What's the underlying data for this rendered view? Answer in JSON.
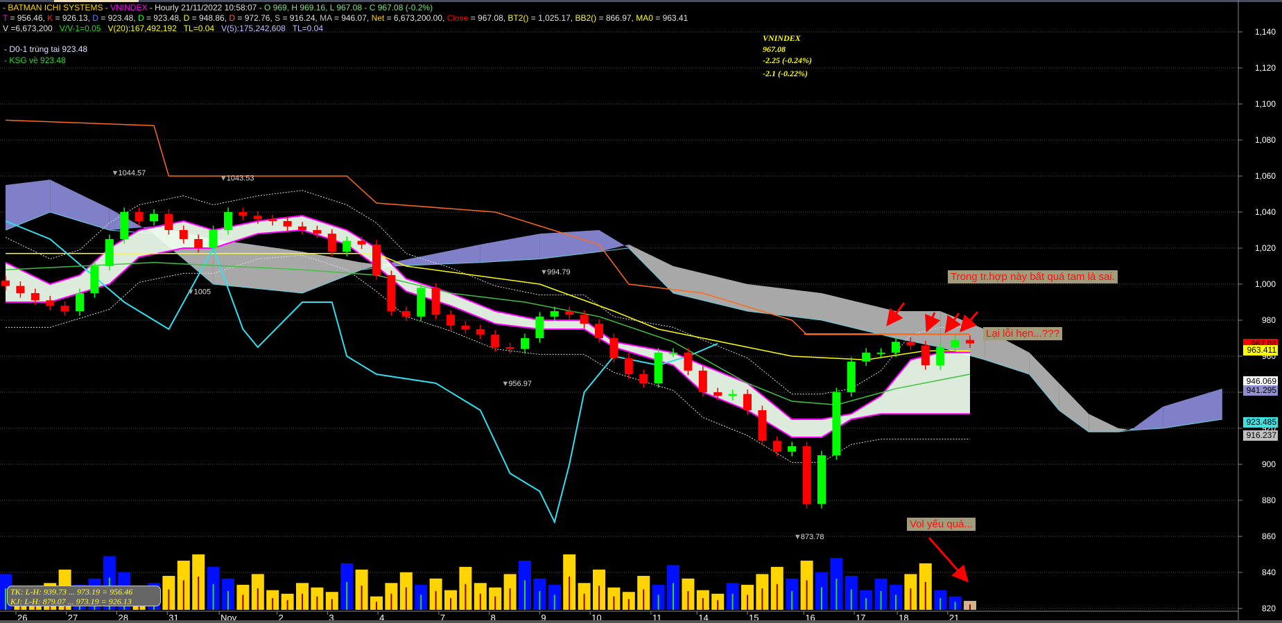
{
  "header": {
    "line1": {
      "prefix": "- BATMAN  ICHI SYSTEMS - ",
      "symbol": "VNINDEX",
      "rest": " - Hourly 21/11/2022 10:58:07 - ",
      "ohlc": "O 969, H 969.16, L 967.08 - C 967.08 (-0.2%)"
    },
    "line2": [
      {
        "k": "T",
        "v": " = 956.46, ",
        "c": "#ff00ff"
      },
      {
        "k": "K",
        "v": " = 926.13, ",
        "c": "#ff2020"
      },
      {
        "k": "D",
        "v": " = 923.48, ",
        "c": "#6080ff"
      },
      {
        "k": "D",
        "v": " = 923.48, ",
        "c": "#20ff20"
      },
      {
        "k": "D",
        "v": " = 948.86, ",
        "c": "#ffff00"
      },
      {
        "k": "D",
        "v": " = 972.76, ",
        "c": "#ff6020"
      },
      {
        "k": "S",
        "v": " = 916.24, ",
        "c": "#c0c0c0"
      },
      {
        "k": "MA",
        "v": " = 946.07, ",
        "c": "#c0c0c0"
      },
      {
        "k": "Net",
        "v": " = 6,673,200.00, ",
        "c": "#ffcc00"
      },
      {
        "k": "Close",
        "v": " = 967.08, ",
        "c": "#ff0000"
      },
      {
        "k": "BT2()",
        "v": " = 1,025.17, ",
        "c": "#ffff00"
      },
      {
        "k": "BB2()",
        "v": " = 866.97, ",
        "c": "#ffff00"
      },
      {
        "k": "MA0",
        "v": " = 963.41",
        "c": "#ffff00"
      }
    ],
    "line3": {
      "v": "V =6,673,200",
      "vv": "V/V-1=0.05",
      "v20": "V(20):167,492,192",
      "tl1": "TL=0.04",
      "v5": "V(5):175,242,608",
      "tl2": "TL=0.04"
    }
  },
  "notes": [
    "- D0-1 trùng tai 923.48",
    "- KSG về 923.48"
  ],
  "quote_box": {
    "symbol": "VNINDEX",
    "price": "967.08",
    "change1": "-2.25 (-0.24%)",
    "change2": "-2.1 (-0.22%)"
  },
  "callouts": {
    "c1": "Trong tr.hợp này bất quá tam là sai.",
    "c2": "Lại lỗi hẹn...???",
    "c3": "Vol yếu quá..."
  },
  "tk_box": {
    "tk": "TK:  L-H: 939.73  ...  973.19  =  956.46",
    "kj": "KJ:  L-H: 879.07  ...  973.19  =  926.13"
  },
  "price_tags": [
    {
      "label": "967.08",
      "bg": "#ff0000",
      "fg": "#000000",
      "value": 967.08
    },
    {
      "label": "963.411",
      "bg": "#ffff00",
      "fg": "#000000",
      "value": 963.411
    },
    {
      "label": "946.069",
      "bg": "#ffffff",
      "fg": "#000000",
      "value": 946.069
    },
    {
      "label": "941.295",
      "bg": "#9090d0",
      "fg": "#000000",
      "value": 941.295
    },
    {
      "label": "923.485",
      "bg": "#40e0e0",
      "fg": "#000000",
      "value": 923.485
    },
    {
      "label": "916.237",
      "bg": "#c0c0c0",
      "fg": "#000000",
      "value": 916.237
    }
  ],
  "chart_data": {
    "type": "candlestick",
    "title": "VNINDEX Hourly",
    "ylim": [
      812,
      1150
    ],
    "yticks": [
      "1,140",
      "1,120",
      "1,100",
      "1,080",
      "1,060",
      "1,040",
      "1,020",
      "1,000",
      "980",
      "960",
      "940",
      "920",
      "900",
      "880",
      "860",
      "840",
      "820"
    ],
    "ytick_values": [
      1140,
      1120,
      1100,
      1080,
      1060,
      1040,
      1020,
      1000,
      980,
      960,
      940,
      920,
      900,
      880,
      860,
      840,
      820
    ],
    "xticks": [
      {
        "label": "26",
        "i": 0.7
      },
      {
        "label": "27",
        "i": 4.1
      },
      {
        "label": "28",
        "i": 7.5
      },
      {
        "label": "31",
        "i": 10.9
      },
      {
        "label": "Nov",
        "i": 14.4
      },
      {
        "label": "2",
        "i": 18.3
      },
      {
        "label": "3",
        "i": 21.7
      },
      {
        "label": "4",
        "i": 25.1
      },
      {
        "label": "7",
        "i": 29.2
      },
      {
        "label": "8",
        "i": 32.6
      },
      {
        "label": "9",
        "i": 36
      },
      {
        "label": "10",
        "i": 39.4
      },
      {
        "label": "11",
        "i": 43.5
      },
      {
        "label": "14",
        "i": 46.6
      },
      {
        "label": "15",
        "i": 50
      },
      {
        "label": "16",
        "i": 53.8
      },
      {
        "label": "17",
        "i": 57.2
      },
      {
        "label": "18",
        "i": 60.1
      },
      {
        "label": "21",
        "i": 63.5
      }
    ],
    "close": [
      999,
      995,
      991,
      988,
      985,
      995,
      1010,
      1025,
      1040,
      1035,
      1039,
      1030,
      1025,
      1020,
      1030,
      1040,
      1038,
      1036,
      1035,
      1032,
      1030,
      1028,
      1018,
      1024,
      1022,
      1005,
      985,
      982,
      998,
      983,
      977,
      975,
      972,
      965,
      964,
      970,
      982,
      985,
      983,
      978,
      970,
      959,
      950,
      945,
      962,
      962,
      952,
      940,
      938,
      939,
      930,
      913,
      907,
      910,
      878,
      905,
      940,
      957,
      962,
      962,
      968,
      966,
      955,
      965,
      969,
      967.08
    ],
    "volume": [
      40,
      22,
      18,
      30,
      45,
      28,
      35,
      60,
      42,
      25,
      30,
      38,
      55,
      62,
      48,
      35,
      28,
      40,
      22,
      18,
      30,
      25,
      20,
      52,
      45,
      15,
      30,
      42,
      28,
      35,
      22,
      48,
      30,
      25,
      40,
      55,
      35,
      28,
      62,
      30,
      45,
      25,
      20,
      38,
      28,
      50,
      35,
      22,
      18,
      30,
      28,
      40,
      48,
      35,
      55,
      42,
      58,
      38,
      22,
      35,
      28,
      40,
      52,
      22,
      15,
      10
    ],
    "cloud": [
      [
        0,
        1055,
        1030
      ],
      [
        3,
        1058,
        1040
      ],
      [
        7,
        1042,
        1030
      ],
      [
        10,
        1028,
        1032
      ],
      [
        14,
        1000,
        1025
      ],
      [
        20,
        995,
        1018
      ],
      [
        24,
        1008,
        1012
      ],
      [
        26,
        1012,
        1010
      ],
      [
        32,
        1022,
        1012
      ],
      [
        36,
        1028,
        1014
      ],
      [
        40,
        1030,
        1018
      ],
      [
        42,
        1020,
        1022
      ],
      [
        45,
        995,
        1010
      ],
      [
        50,
        985,
        1000
      ],
      [
        55,
        980,
        995
      ],
      [
        60,
        970,
        985
      ],
      [
        63,
        965,
        985
      ],
      [
        66,
        958,
        975
      ],
      [
        69,
        950,
        962
      ],
      [
        71,
        930,
        945
      ],
      [
        73,
        918,
        928
      ],
      [
        75,
        918,
        920
      ],
      [
        76,
        920,
        919
      ],
      [
        78,
        932,
        920
      ],
      [
        82,
        942,
        925
      ]
    ],
    "band": [
      [
        0,
        1012,
        990
      ],
      [
        3,
        1000,
        990
      ],
      [
        5,
        1005,
        995
      ],
      [
        7,
        1020,
        1000
      ],
      [
        9,
        1030,
        1015
      ],
      [
        12,
        1035,
        1020
      ],
      [
        14,
        1030,
        1020
      ],
      [
        17,
        1035,
        1028
      ],
      [
        20,
        1038,
        1030
      ],
      [
        23,
        1030,
        1022
      ],
      [
        25,
        1020,
        1010
      ],
      [
        27,
        1003,
        996
      ],
      [
        30,
        995,
        988
      ],
      [
        33,
        985,
        978
      ],
      [
        36,
        980,
        975
      ],
      [
        39,
        980,
        975
      ],
      [
        41,
        968,
        965
      ],
      [
        43,
        965,
        960
      ],
      [
        45,
        962,
        955
      ],
      [
        47,
        955,
        940
      ],
      [
        50,
        945,
        930
      ],
      [
        53,
        925,
        915
      ],
      [
        55,
        925,
        915
      ],
      [
        57,
        928,
        925
      ],
      [
        59,
        938,
        928
      ],
      [
        61,
        958,
        928
      ],
      [
        63,
        962,
        928
      ],
      [
        65,
        962,
        928
      ]
    ],
    "lines": [
      {
        "name": "kijun",
        "color": "#ff6a1a",
        "points": [
          [
            0,
            1091
          ],
          [
            10,
            1088
          ],
          [
            11,
            1060
          ],
          [
            23,
            1060
          ],
          [
            25,
            1045
          ],
          [
            33,
            1040
          ],
          [
            40,
            1022
          ],
          [
            42,
            1000
          ],
          [
            47,
            995
          ],
          [
            53,
            980
          ],
          [
            54,
            972
          ],
          [
            65,
            972
          ]
        ]
      },
      {
        "name": "tenkan",
        "color": "#ffff00",
        "points": [
          [
            0,
            1017
          ],
          [
            25,
            1017
          ],
          [
            27,
            1010
          ],
          [
            36,
            1000
          ],
          [
            41,
            985
          ],
          [
            44,
            975
          ],
          [
            53,
            960
          ],
          [
            58,
            958
          ],
          [
            62,
            963
          ],
          [
            65,
            963
          ]
        ]
      },
      {
        "name": "chikou",
        "color": "#30e0f0",
        "points": [
          [
            0,
            1035
          ],
          [
            3,
            1025
          ],
          [
            8,
            990
          ],
          [
            11,
            975
          ],
          [
            14,
            1020
          ],
          [
            16,
            975
          ],
          [
            17,
            965
          ],
          [
            20,
            990
          ],
          [
            22,
            990
          ],
          [
            23,
            960
          ],
          [
            25,
            950
          ],
          [
            29,
            945
          ],
          [
            31,
            935
          ],
          [
            32,
            930
          ],
          [
            34,
            895
          ],
          [
            36,
            885
          ],
          [
            37,
            868
          ],
          [
            38,
            900
          ],
          [
            39,
            940
          ],
          [
            41,
            960
          ],
          [
            44,
            955
          ],
          [
            46,
            960
          ],
          [
            48,
            967
          ]
        ]
      },
      {
        "name": "ma",
        "color": "#40c040",
        "points": [
          [
            0,
            1008
          ],
          [
            10,
            1012
          ],
          [
            20,
            1008
          ],
          [
            25,
            1005
          ],
          [
            30,
            995
          ],
          [
            35,
            990
          ],
          [
            40,
            982
          ],
          [
            45,
            968
          ],
          [
            50,
            945
          ],
          [
            53,
            935
          ],
          [
            56,
            933
          ],
          [
            60,
            942
          ],
          [
            65,
            950
          ]
        ]
      }
    ],
    "labels": [
      {
        "text": "1044.57",
        "i": 7.5,
        "v": 1062
      },
      {
        "text": "1043.53",
        "i": 14.8,
        "v": 1059
      },
      {
        "text": "1005",
        "i": 12.6,
        "v": 996
      },
      {
        "text": "994.79",
        "i": 36.4,
        "v": 1007
      },
      {
        "text": "956.97",
        "i": 33.8,
        "v": 945
      },
      {
        "text": "873.78",
        "i": 53.5,
        "v": 860
      }
    ]
  }
}
